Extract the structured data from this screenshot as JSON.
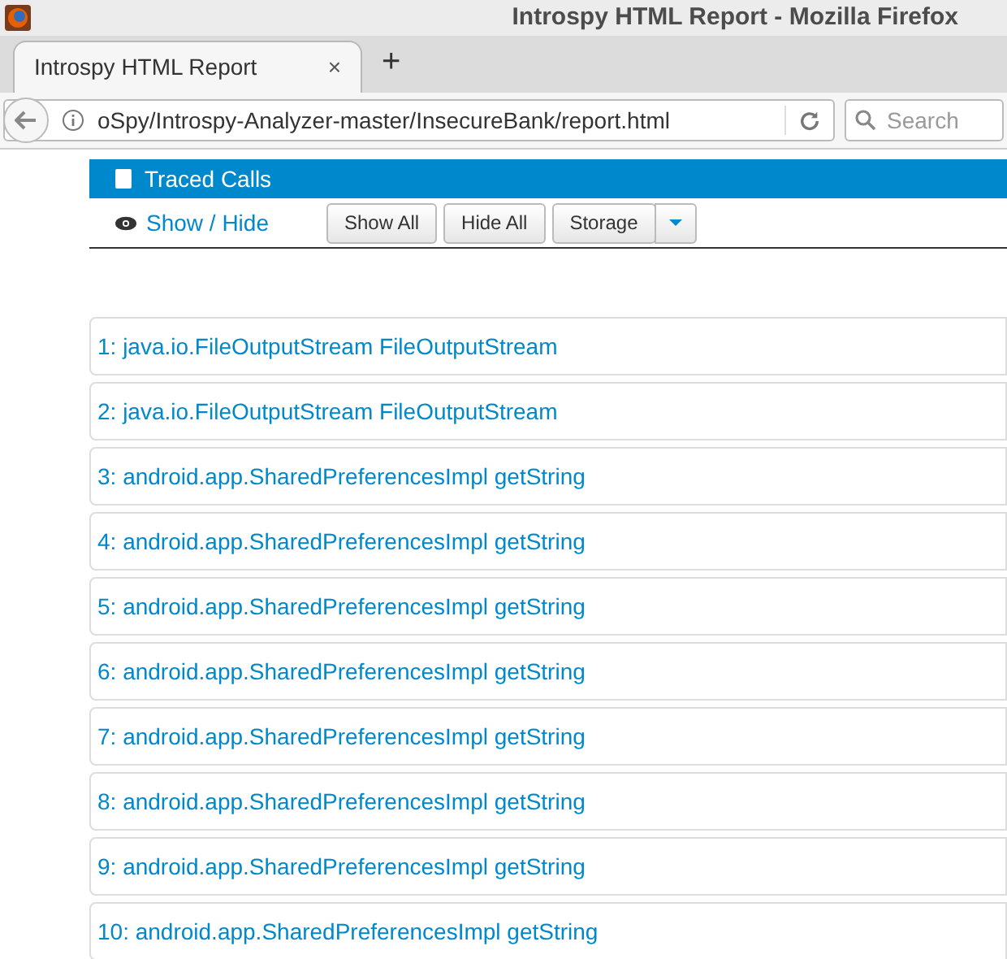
{
  "window": {
    "title": "Introspy HTML Report - Mozilla Firefox"
  },
  "tabs": [
    {
      "label": "Introspy HTML Report",
      "selected": true,
      "close": "×"
    }
  ],
  "new_tab": "+",
  "address_bar": {
    "value": "oSpy/Introspy-Analyzer-master/InsecureBank/report.html"
  },
  "search": {
    "placeholder": "Search"
  },
  "panel": {
    "title": "Traced Calls",
    "toggle": "Show / Hide",
    "buttons": [
      "Show All",
      "Hide All",
      "Storage"
    ]
  },
  "calls": [
    "1: java.io.FileOutputStream FileOutputStream",
    "2: java.io.FileOutputStream FileOutputStream",
    "3: android.app.SharedPreferencesImpl getString",
    "4: android.app.SharedPreferencesImpl getString",
    "5: android.app.SharedPreferencesImpl getString",
    "6: android.app.SharedPreferencesImpl getString",
    "7: android.app.SharedPreferencesImpl getString",
    "8: android.app.SharedPreferencesImpl getString",
    "9: android.app.SharedPreferencesImpl getString",
    "10: android.app.SharedPreferencesImpl getString"
  ]
}
